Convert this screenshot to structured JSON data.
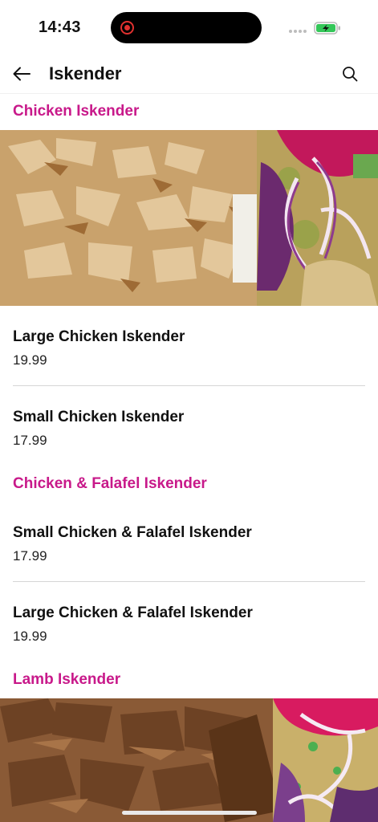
{
  "status_bar": {
    "time": "14:43"
  },
  "header": {
    "title": "Iskender"
  },
  "sections": [
    {
      "title": "Chicken Iskender",
      "items": [
        {
          "name": "Large Chicken Iskender",
          "price": "19.99"
        },
        {
          "name": "Small Chicken Iskender",
          "price": "17.99"
        }
      ]
    },
    {
      "title": "Chicken & Falafel Iskender",
      "items": [
        {
          "name": "Small Chicken & Falafel Iskender",
          "price": "17.99"
        },
        {
          "name": "Large Chicken & Falafel Iskender",
          "price": "19.99"
        }
      ]
    },
    {
      "title": "Lamb Iskender",
      "items": []
    }
  ],
  "colors": {
    "accent": "#c8198a",
    "divider": "#d6d6d6",
    "battery": "#34c759"
  },
  "icons": [
    "back-arrow-icon",
    "search-icon",
    "recording-icon",
    "signal-icon",
    "battery-charging-icon"
  ]
}
